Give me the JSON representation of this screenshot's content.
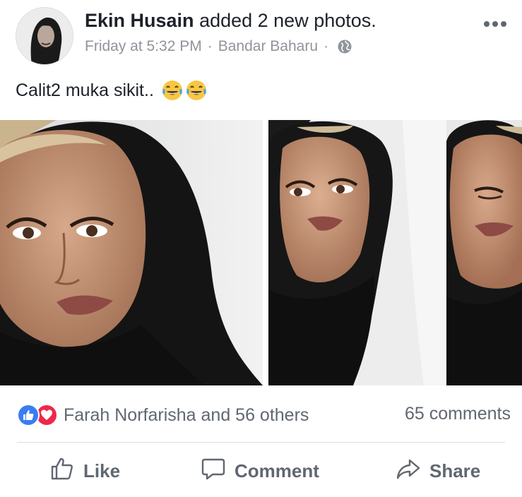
{
  "post": {
    "author": "Ekin Husain",
    "action_text": "added 2 new photos.",
    "timestamp": "Friday at 5:32 PM",
    "separator": "·",
    "location": "Bandar Baharu",
    "privacy_icon": "globe-icon",
    "menu_icon": "more-options-icon",
    "caption": "Calit2 muka sikit..",
    "caption_emoji": [
      "face-with-tears-of-joy-emoji",
      "face-with-tears-of-joy-emoji"
    ]
  },
  "photos": [
    {
      "name": "photo-1",
      "subject": "selfie-black-hijab-front"
    },
    {
      "name": "photo-2",
      "subject": "selfie-black-hijab-side"
    },
    {
      "name": "photo-3",
      "subject": "selfie-black-hijab-eyes-closed"
    }
  ],
  "stats": {
    "reactions": [
      "like",
      "love"
    ],
    "reactors_text": "Farah Norfarisha and 56 others",
    "comments_text": "65 comments"
  },
  "actions": {
    "like": "Like",
    "comment": "Comment",
    "share": "Share"
  },
  "colors": {
    "like_blue": "#3b7cf3",
    "love_red": "#f0284a",
    "muted_text": "#606770",
    "meta_text": "#90949c"
  }
}
